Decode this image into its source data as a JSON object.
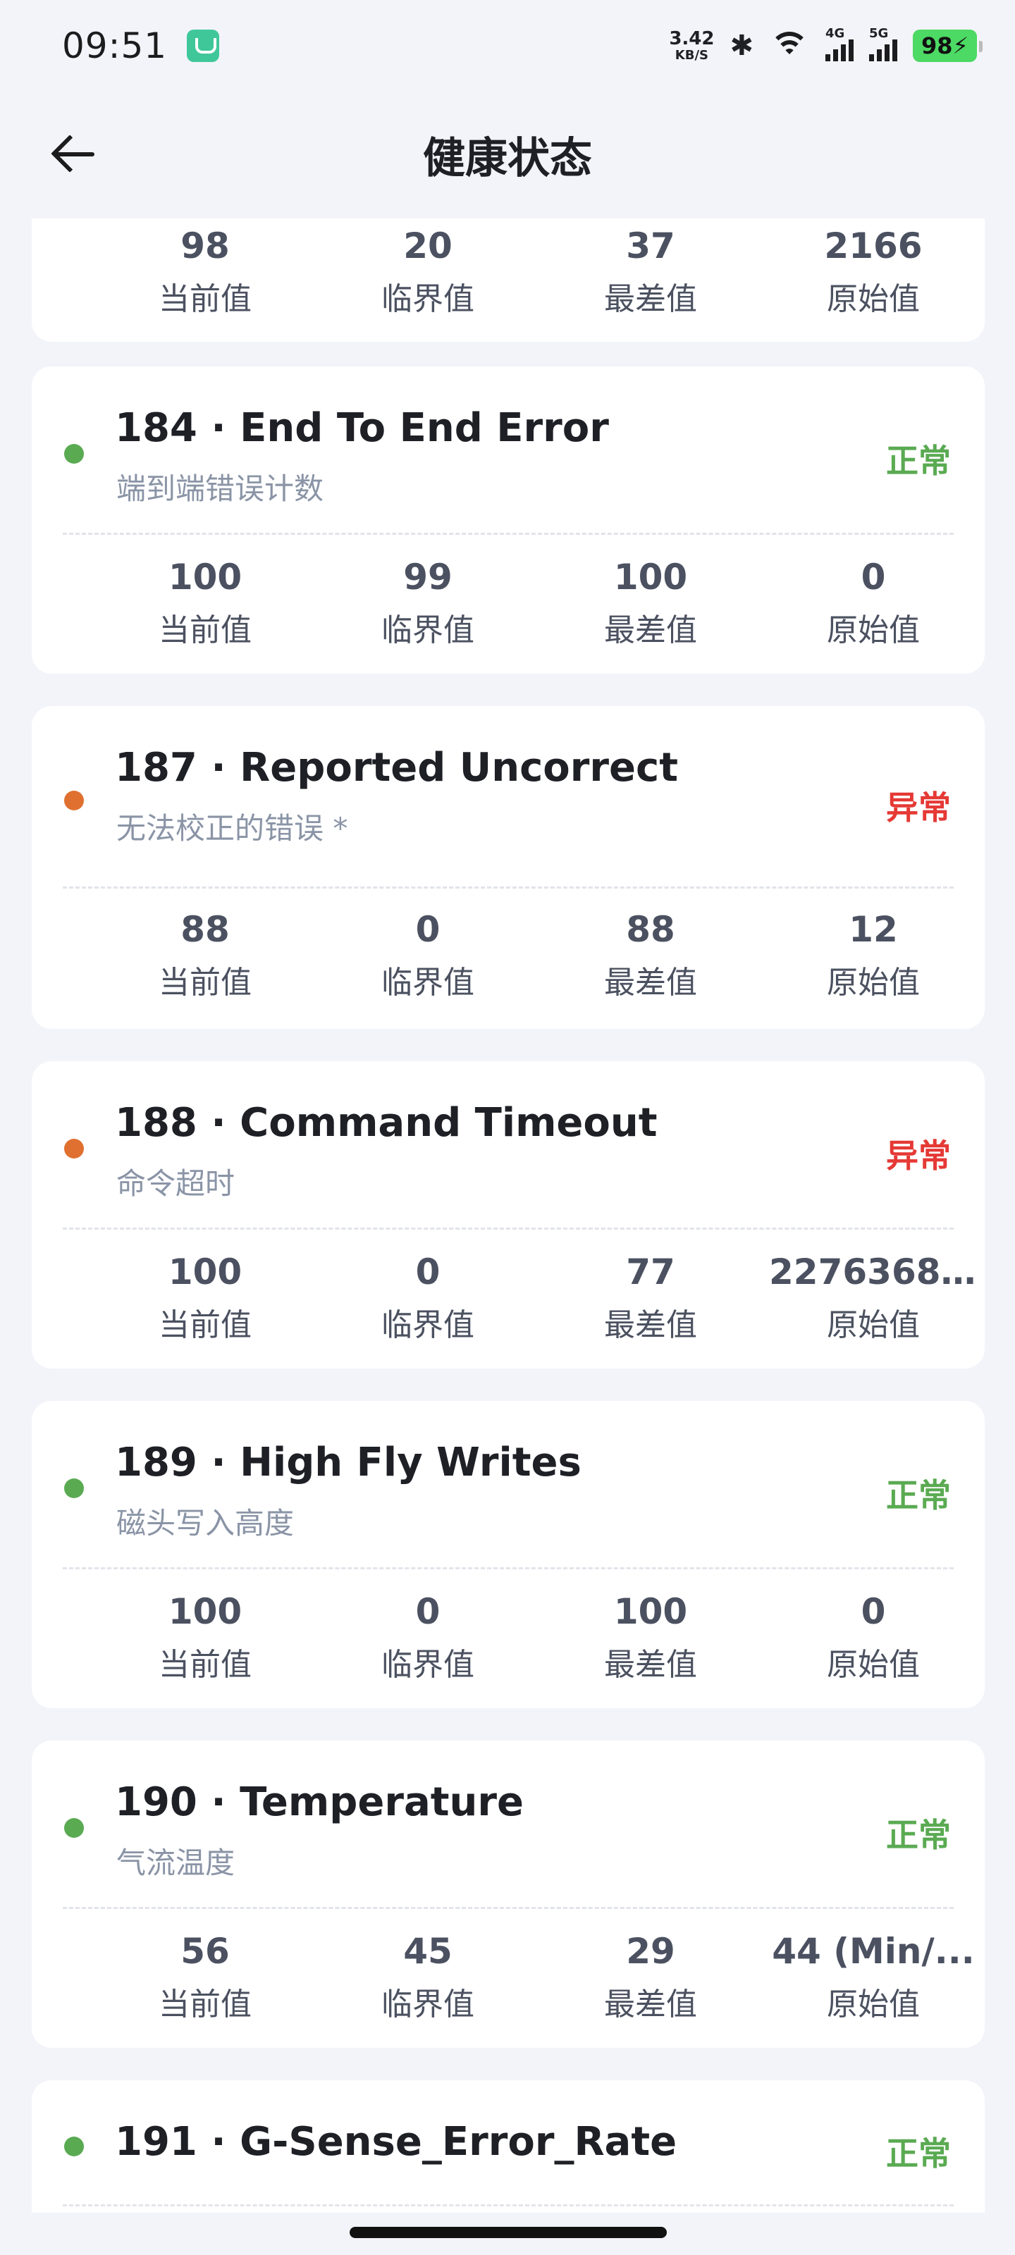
{
  "status_bar": {
    "time": "09:51",
    "net_speed_value": "3.42",
    "net_speed_unit": "KB/S",
    "bluetooth_icon": "bluetooth-icon",
    "sig1_label": "4G",
    "sig2_label": "5G",
    "battery": "98"
  },
  "header": {
    "title": "健康状态"
  },
  "labels": {
    "current": "当前值",
    "threshold": "临界值",
    "worst": "最差值",
    "raw": "原始值"
  },
  "colors": {
    "ok": "#5aaa52",
    "bad": "#e53935",
    "ok_dot": "#5aaa52",
    "bad_dot": "#e07030"
  },
  "cards": [
    {
      "values": [
        "98",
        "20",
        "37",
        "2166"
      ]
    },
    {
      "id_name": "184 · End To End Error",
      "desc": "端到端错误计数",
      "status": "正常",
      "values": [
        "100",
        "99",
        "100",
        "0"
      ]
    },
    {
      "id_name": "187 · Reported Uncorrect",
      "desc": "无法校正的错误 *",
      "status": "异常",
      "values": [
        "88",
        "0",
        "88",
        "12"
      ]
    },
    {
      "id_name": "188 · Command Timeout",
      "desc": "命令超时",
      "status": "异常",
      "values": [
        "100",
        "0",
        "77",
        "22763687..."
      ]
    },
    {
      "id_name": "189 · High Fly Writes",
      "desc": "磁头写入高度",
      "status": "正常",
      "values": [
        "100",
        "0",
        "100",
        "0"
      ]
    },
    {
      "id_name": "190 · Temperature",
      "desc": "气流温度",
      "status": "正常",
      "values": [
        "56",
        "45",
        "29",
        "44 (Min/..."
      ]
    },
    {
      "id_name": "191 · G-Sense_Error_Rate",
      "status": "正常"
    }
  ]
}
